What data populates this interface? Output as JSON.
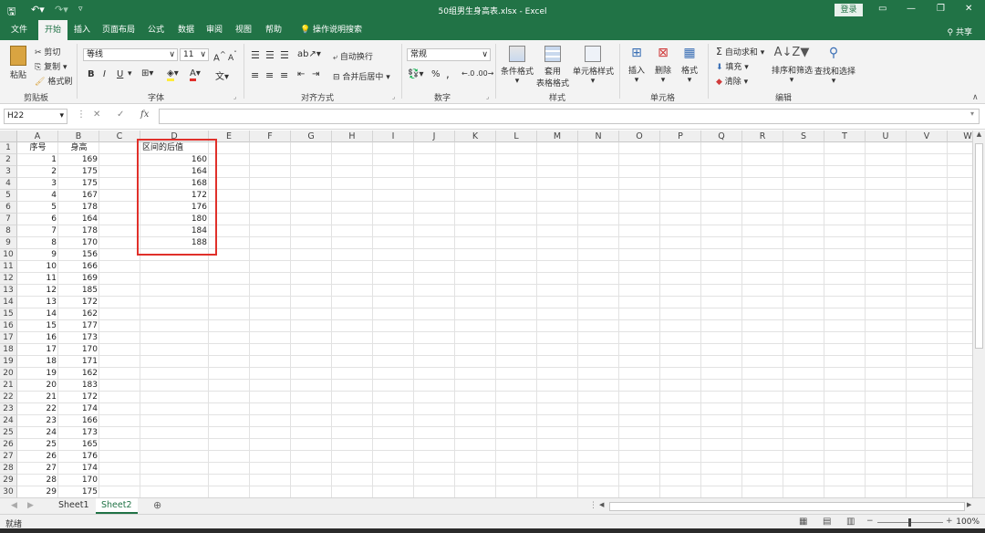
{
  "titlebar": {
    "title": "50组男生身高表.xlsx - Excel",
    "login": "登录",
    "qa_save_icon": "save-icon",
    "qa_undo_icon": "undo-icon",
    "qa_redo_icon": "redo-icon"
  },
  "tabs": [
    "文件",
    "开始",
    "插入",
    "页面布局",
    "公式",
    "数据",
    "审阅",
    "视图",
    "帮助"
  ],
  "active_tab": "开始",
  "tell_me": "操作说明搜索",
  "share": "共享",
  "ribbon": {
    "clipboard": {
      "label": "剪贴板",
      "paste": "粘贴",
      "cut": "剪切",
      "copy": "复制",
      "format_painter": "格式刷"
    },
    "font": {
      "label": "字体",
      "font_name": "等线",
      "font_size": "11",
      "bold": "B",
      "italic": "I",
      "underline": "U",
      "grow": "A",
      "shrink": "A",
      "font_color": "A",
      "phonetic": "文"
    },
    "alignment": {
      "label": "对齐方式",
      "wrap": "自动换行",
      "merge": "合并后居中"
    },
    "number": {
      "label": "数字",
      "format": "常规",
      "percent": "%",
      "comma": ","
    },
    "styles": {
      "label": "样式",
      "conditional": "条件格式",
      "table_line1": "套用",
      "table_line2": "表格格式",
      "cell_styles": "单元格样式"
    },
    "cells": {
      "label": "单元格",
      "insert": "插入",
      "delete": "删除",
      "format": "格式"
    },
    "editing": {
      "label": "编辑",
      "autosum": "自动求和",
      "fill": "填充",
      "clear": "清除",
      "sort": "排序和筛选",
      "find": "查找和选择"
    }
  },
  "formula_bar": {
    "name_box": "H22",
    "fx": "fx",
    "value": ""
  },
  "columns": [
    "A",
    "B",
    "C",
    "D",
    "E",
    "F",
    "G",
    "H",
    "I",
    "J",
    "K",
    "L",
    "M",
    "N",
    "O",
    "P",
    "Q",
    "R",
    "S",
    "T",
    "U",
    "V",
    "W"
  ],
  "rows": [
    "1",
    "2",
    "3",
    "4",
    "5",
    "6",
    "7",
    "8",
    "9",
    "10",
    "11",
    "12",
    "13",
    "14",
    "15",
    "16",
    "17",
    "18",
    "19",
    "20",
    "21",
    "22",
    "23",
    "24",
    "25",
    "26",
    "27",
    "28",
    "29",
    "30"
  ],
  "headers": {
    "A1": "序号",
    "B1": "身高",
    "D1": "区间的后值"
  },
  "col_a": [
    "1",
    "2",
    "3",
    "4",
    "5",
    "6",
    "7",
    "8",
    "9",
    "10",
    "11",
    "12",
    "13",
    "14",
    "15",
    "16",
    "17",
    "18",
    "19",
    "20",
    "21",
    "22",
    "23",
    "24",
    "25",
    "26",
    "27",
    "28",
    "29"
  ],
  "col_b": [
    "169",
    "175",
    "175",
    "167",
    "178",
    "164",
    "178",
    "170",
    "156",
    "166",
    "169",
    "185",
    "172",
    "162",
    "177",
    "173",
    "170",
    "171",
    "162",
    "183",
    "172",
    "174",
    "166",
    "173",
    "165",
    "176",
    "174",
    "170",
    "175"
  ],
  "col_d": [
    "160",
    "164",
    "168",
    "172",
    "176",
    "180",
    "184",
    "188"
  ],
  "sheets": [
    "Sheet1",
    "Sheet2"
  ],
  "active_sheet": "Sheet2",
  "status": {
    "ready": "就绪",
    "zoom": "100%"
  }
}
